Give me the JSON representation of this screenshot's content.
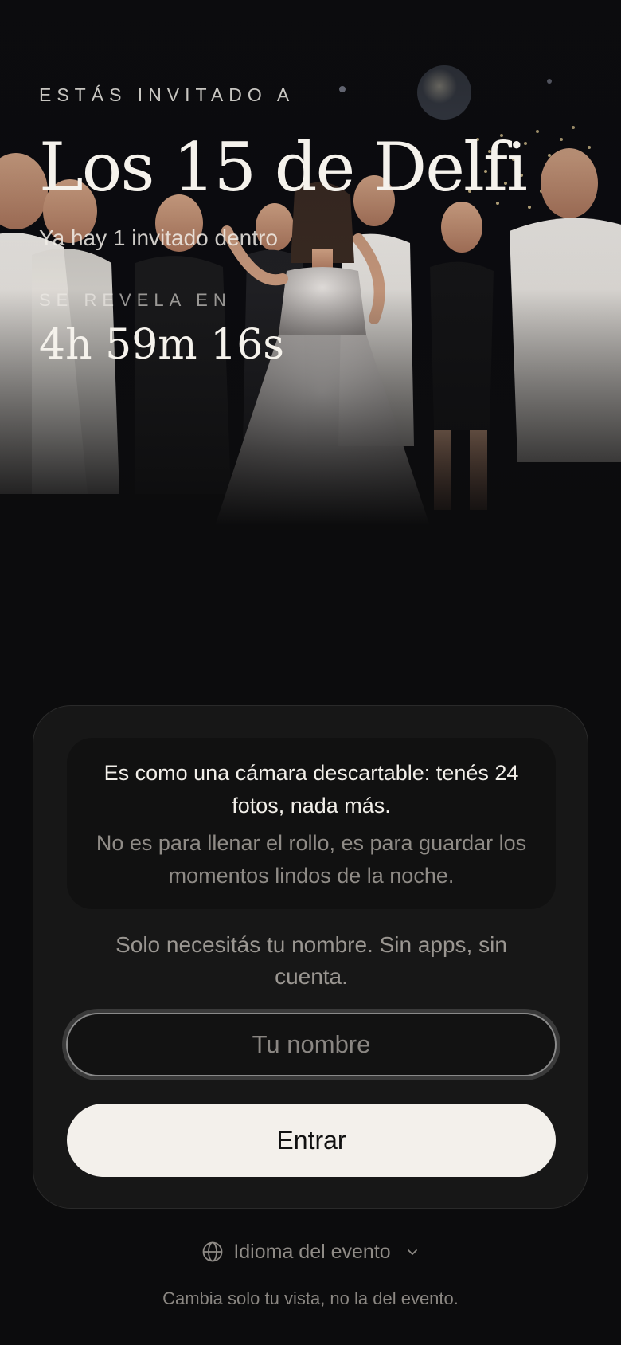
{
  "hero": {
    "eyebrow": "ESTÁS INVITADO A",
    "event_title": "Los 15 de Delfi",
    "guest_count_text": "Ya hay 1 invitado dentro",
    "reveal_label": "SE REVELA EN",
    "countdown": "4h 59m 16s"
  },
  "card": {
    "info_main": "Es como una cámara descartable: tenés 24 fotos, nada más.",
    "info_sub": "No es para llenar el rollo, es para guardar los momentos lindos de la noche.",
    "hint": "Solo necesitás tu nombre. Sin apps, sin cuenta.",
    "name_input": {
      "placeholder": "Tu nombre",
      "value": ""
    },
    "enter_label": "Entrar"
  },
  "language": {
    "label": "Idioma del evento",
    "note": "Cambia solo tu vista, no la del evento.",
    "icon": "globe-icon"
  },
  "colors": {
    "background": "#0c0c0d",
    "card": "#171717",
    "button": "#f3f0eb",
    "muted_text": "#8f8b86"
  }
}
